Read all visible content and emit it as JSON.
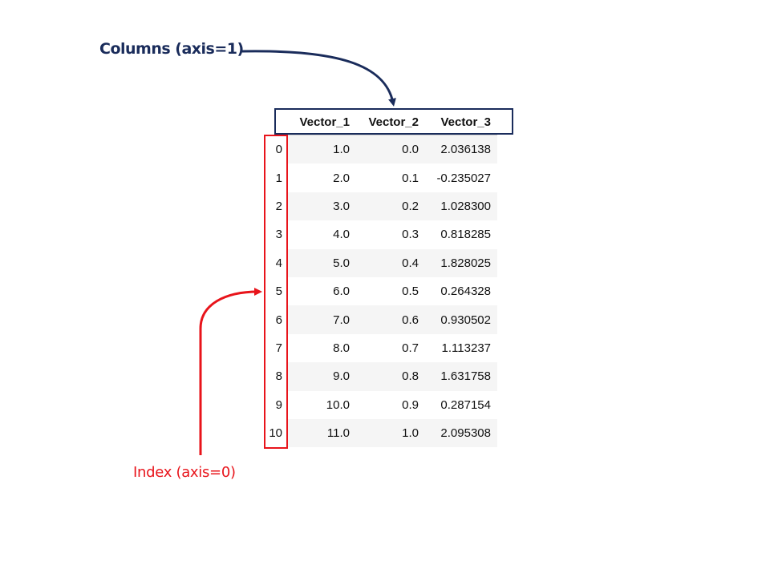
{
  "annotations": {
    "columns_label": "Columns (axis=1)",
    "index_label": "Index (axis=0)"
  },
  "colors": {
    "columns_accent": "#1a2c5b",
    "index_accent": "#e8141b",
    "stripe": "#f5f5f5"
  },
  "table": {
    "columns": [
      "Vector_1",
      "Vector_2",
      "Vector_3"
    ],
    "rows": [
      {
        "index": "0",
        "values": [
          "1.0",
          "0.0",
          "2.036138"
        ]
      },
      {
        "index": "1",
        "values": [
          "2.0",
          "0.1",
          "-0.235027"
        ]
      },
      {
        "index": "2",
        "values": [
          "3.0",
          "0.2",
          "1.028300"
        ]
      },
      {
        "index": "3",
        "values": [
          "4.0",
          "0.3",
          "0.818285"
        ]
      },
      {
        "index": "4",
        "values": [
          "5.0",
          "0.4",
          "1.828025"
        ]
      },
      {
        "index": "5",
        "values": [
          "6.0",
          "0.5",
          "0.264328"
        ]
      },
      {
        "index": "6",
        "values": [
          "7.0",
          "0.6",
          "0.930502"
        ]
      },
      {
        "index": "7",
        "values": [
          "8.0",
          "0.7",
          "1.113237"
        ]
      },
      {
        "index": "8",
        "values": [
          "9.0",
          "0.8",
          "1.631758"
        ]
      },
      {
        "index": "9",
        "values": [
          "10.0",
          "0.9",
          "0.287154"
        ]
      },
      {
        "index": "10",
        "values": [
          "11.0",
          "1.0",
          "2.095308"
        ]
      }
    ]
  }
}
